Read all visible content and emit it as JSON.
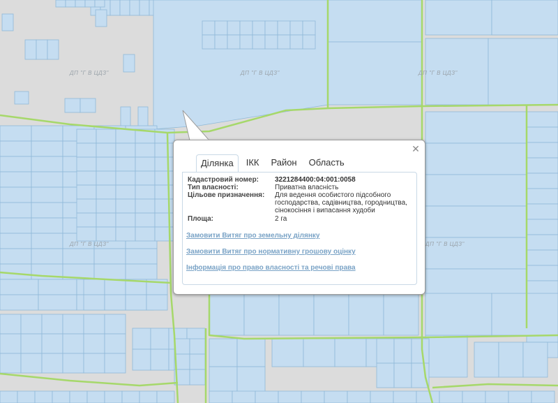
{
  "map": {
    "watermark_text": "ДП \"Г В ЦДЗ\"",
    "colors": {
      "background": "#dcdcdc",
      "parcel_fill": "#c5ddf1",
      "parcel_stroke": "#8fbad9",
      "boundary_line": "#a6d86a"
    }
  },
  "popup": {
    "close_icon": "close-icon",
    "tabs": [
      {
        "label": "Ділянка",
        "active": true
      },
      {
        "label": "ІКК",
        "active": false
      },
      {
        "label": "Район",
        "active": false
      },
      {
        "label": "Область",
        "active": false
      }
    ],
    "fields": {
      "cadastral_label": "Кадастровий номер:",
      "cadastral_value": "3221284400:04:001:0058",
      "ownership_label": "Тип власності:",
      "ownership_value": "Приватна власність",
      "purpose_label": "Цільове призначення:",
      "purpose_value": "Для ведення особистого підсобного господарства, садівництва, городництва, сінокосіння і випасання худоби",
      "area_label": "Площа:",
      "area_value": "2 га"
    },
    "links": {
      "extract_land": "Замовити Витяг про земельну ділянку",
      "extract_valuation": "Замовити Витяг про нормативну грошову оцінку",
      "rights_info": "Інформація про право власності та речові права"
    }
  }
}
